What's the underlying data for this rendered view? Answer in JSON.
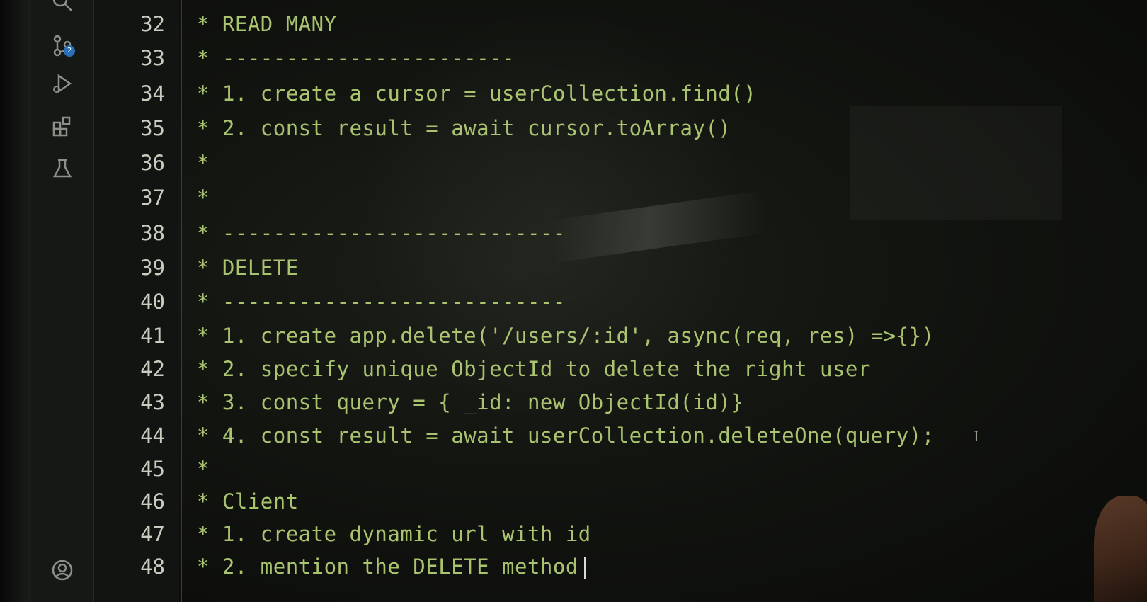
{
  "editor": {
    "lines": [
      {
        "number": "32",
        "text": "* READ MANY"
      },
      {
        "number": "33",
        "text": "* -----------------------"
      },
      {
        "number": "34",
        "text": "* 1. create a cursor = userCollection.find()"
      },
      {
        "number": "35",
        "text": "* 2. const result = await cursor.toArray()"
      },
      {
        "number": "36",
        "text": "*"
      },
      {
        "number": "37",
        "text": "*"
      },
      {
        "number": "38",
        "text": "* ---------------------------"
      },
      {
        "number": "39",
        "text": "* DELETE"
      },
      {
        "number": "40",
        "text": "* ---------------------------"
      },
      {
        "number": "41",
        "text": "* 1. create app.delete('/users/:id', async(req, res) =>{})"
      },
      {
        "number": "42",
        "text": "* 2. specify unique ObjectId to delete the right user"
      },
      {
        "number": "43",
        "text": "* 3. const query = { _id: new ObjectId(id)}"
      },
      {
        "number": "44",
        "text": "* 4. const result = await userCollection.deleteOne(query);"
      },
      {
        "number": "45",
        "text": "*"
      },
      {
        "number": "46",
        "text": "* Client"
      },
      {
        "number": "47",
        "text": "* 1. create dynamic url with id"
      },
      {
        "number": "48",
        "text": "* 2. mention the DELETE method"
      }
    ]
  },
  "activity_bar": {
    "source_control_badge": "2",
    "icons": [
      "search-icon",
      "source-control-icon",
      "run-debug-icon",
      "extensions-icon",
      "testing-icon",
      "account-icon"
    ]
  },
  "colors": {
    "code_text": "#a9c36f",
    "line_numbers": "#c8cdbf",
    "background": "#121410"
  }
}
